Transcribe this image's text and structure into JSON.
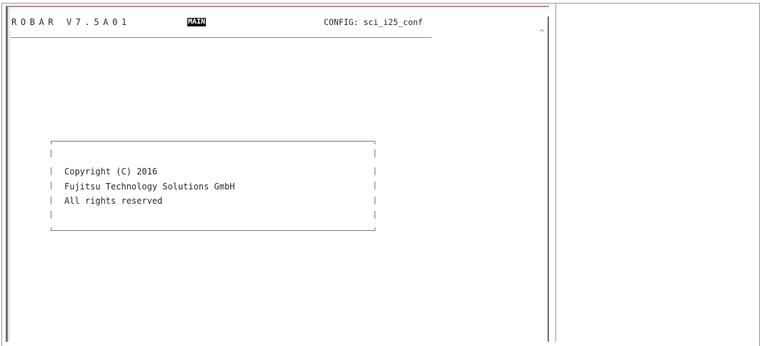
{
  "terminal": {
    "app_name": "ROBAR V7.5A01",
    "mode": "MAIN",
    "config": "CONFIG: sci_i25_conf"
  },
  "copyright_box": {
    "lines": [
      "Copyright (C) 2016",
      "Fujitsu Technology Solutions GmbH",
      "All rights reserved"
    ]
  },
  "icons": {
    "scroll_up": "chevron-up-icon"
  },
  "colors": {
    "terminal_background": "#ffffff",
    "text": "#2a2a2a",
    "mode_badge_background": "#111111",
    "mode_badge_text": "#ffffff"
  }
}
